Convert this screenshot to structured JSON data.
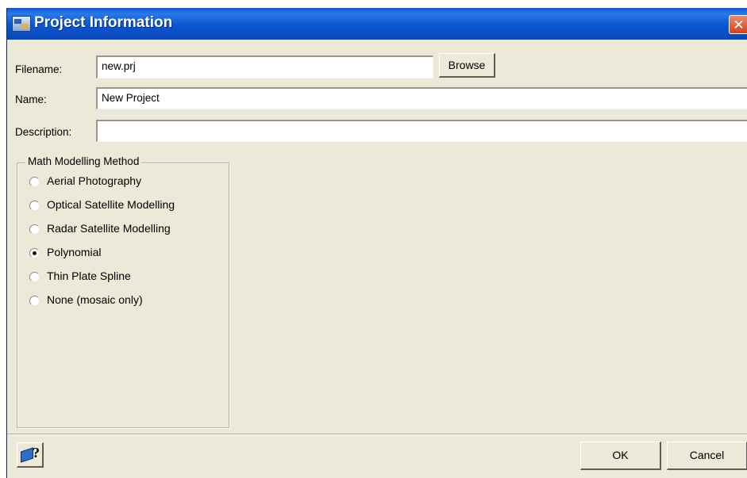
{
  "window": {
    "title": "Project Information",
    "close_symbol": "✕",
    "app_icon": "project-icon",
    "close_icon": "close-icon"
  },
  "form": {
    "filename_label": "Filename:",
    "filename_value": "new.prj",
    "browse_label": "Browse",
    "name_label": "Name:",
    "name_value": "New Project",
    "description_label": "Description:",
    "description_value": ""
  },
  "method": {
    "group_label": "Math Modelling Method",
    "selected": "Polynomial",
    "options": [
      {
        "label": "Aerial Photography",
        "checked": false
      },
      {
        "label": "Optical Satellite Modelling",
        "checked": false
      },
      {
        "label": "Radar Satellite Modelling",
        "checked": false
      },
      {
        "label": "Polynomial",
        "checked": true
      },
      {
        "label": "Thin Plate Spline",
        "checked": false
      },
      {
        "label": "None (mosaic only)",
        "checked": false
      }
    ]
  },
  "footer": {
    "help_icon": "help-book-icon",
    "help_symbol": "?",
    "ok_label": "OK",
    "cancel_label": "Cancel"
  },
  "colors": {
    "titlebar": "#0b5ad6",
    "dialog_bg": "#ece9d8",
    "close_button": "#d2431f"
  }
}
